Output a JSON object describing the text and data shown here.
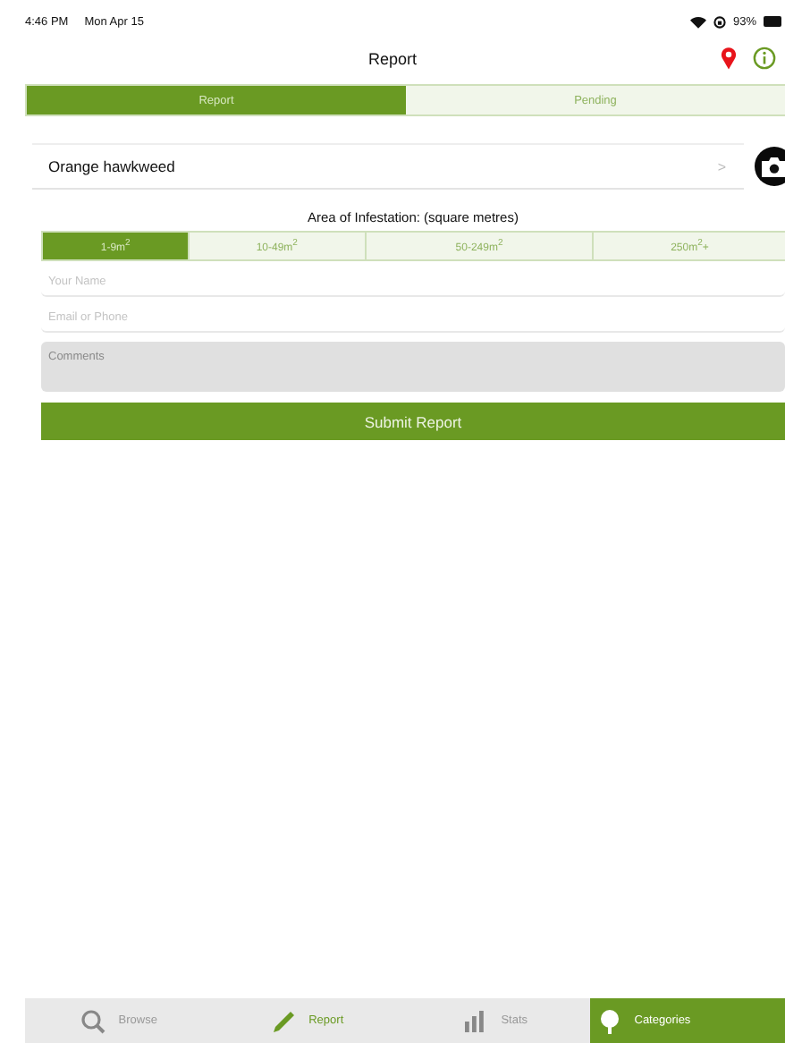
{
  "status_bar": {
    "time": "4:46 PM",
    "date": "Mon Apr 15",
    "battery": "93%"
  },
  "nav": {
    "title": "Report"
  },
  "tabs": [
    {
      "label": "Report",
      "selected": true
    },
    {
      "label": "Pending",
      "selected": false
    }
  ],
  "species": {
    "name": "Orange hawkweed",
    "chevron": ">"
  },
  "area": {
    "label": "Area of Infestation: (square metres)",
    "options": [
      {
        "label": "1-9m$^{2}$",
        "selected": true
      },
      {
        "label": "10-49m$^{2}$",
        "selected": false
      },
      {
        "label": "50-249m$^{2}$",
        "selected": false
      },
      {
        "label": "250m$^{2}$+",
        "selected": false
      }
    ]
  },
  "fields": [
    {
      "kind": "line",
      "placeholder": "Your Name"
    },
    {
      "kind": "line",
      "placeholder": "Email or Phone"
    },
    {
      "kind": "area",
      "placeholder": "Comments"
    }
  ],
  "submit": "Submit Report",
  "tab_bar": [
    {
      "label": "Browse",
      "kind": "search",
      "selected": false,
      "accent": false
    },
    {
      "label": "Report",
      "kind": "pencil",
      "selected": false,
      "accent": true
    },
    {
      "label": "Stats",
      "kind": "bars",
      "selected": false,
      "accent": false
    },
    {
      "label": "Categories",
      "kind": "tree",
      "selected": true,
      "accent": false
    }
  ]
}
